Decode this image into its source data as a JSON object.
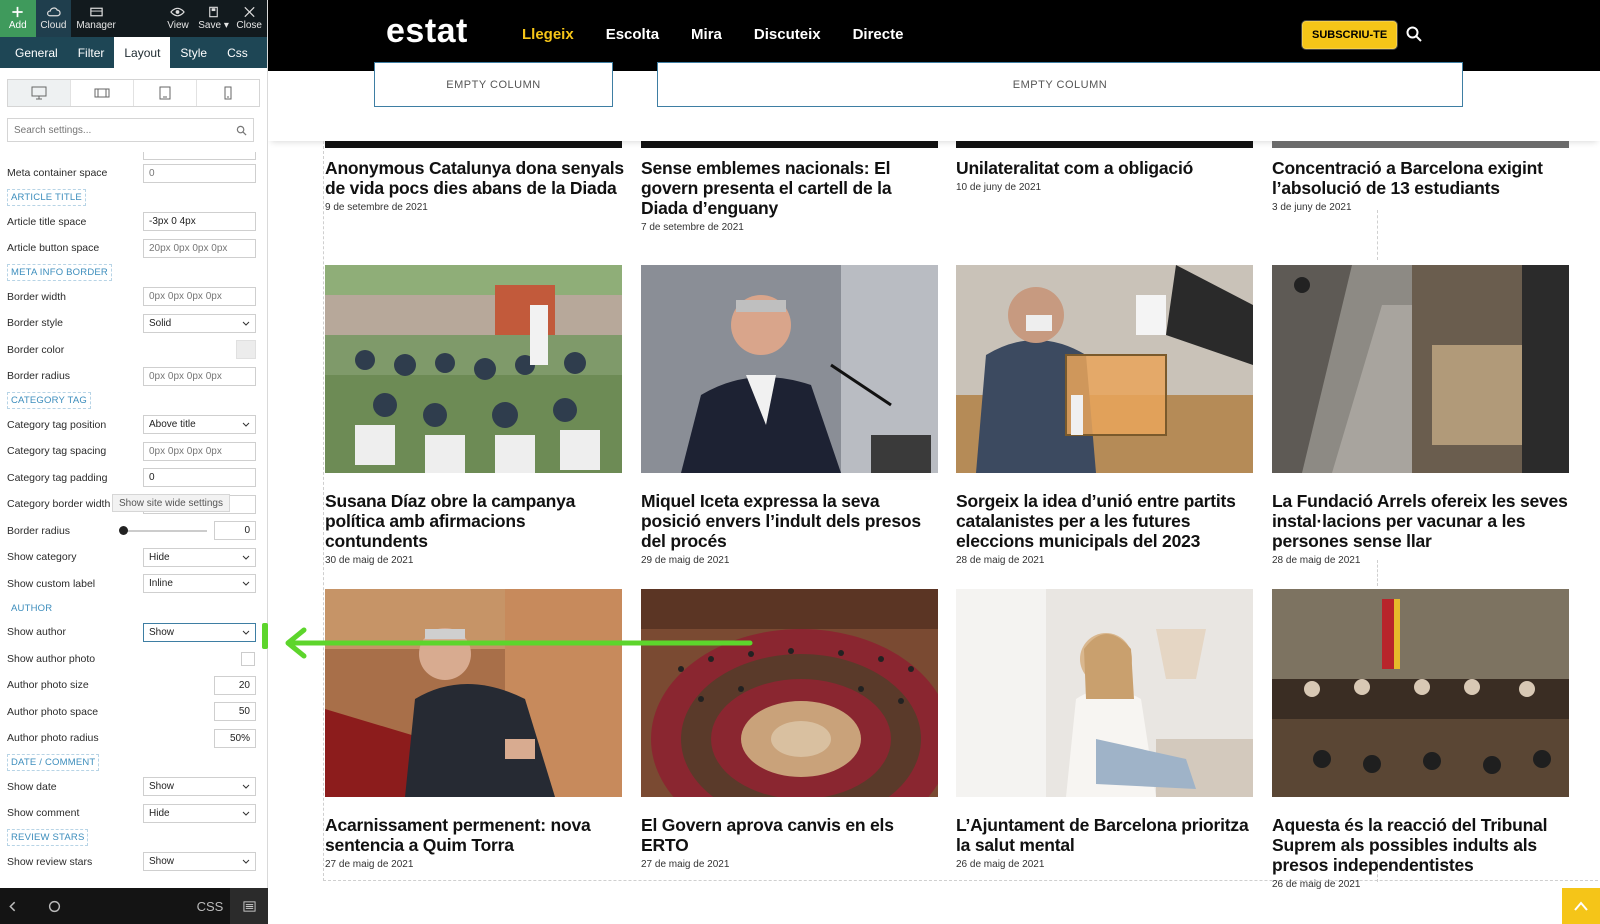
{
  "toolbar": {
    "add": "Add",
    "cloud": "Cloud",
    "manager": "Manager",
    "view": "View",
    "save": "Save",
    "close": "Close"
  },
  "tabs": [
    "General",
    "Filter",
    "Layout",
    "Style",
    "Css"
  ],
  "active_tab": "Layout",
  "search": {
    "placeholder": "Search settings..."
  },
  "settings": {
    "meta_container_space": {
      "label": "Meta container space",
      "value": "0"
    },
    "article_title": {
      "heading": "ARTICLE TITLE",
      "title_space": {
        "label": "Article title space",
        "value": "-3px 0 4px"
      },
      "button_space": {
        "label": "Article button space",
        "value": "20px 0px 0px 0px"
      }
    },
    "meta_info_border": {
      "heading": "META INFO BORDER",
      "width": {
        "label": "Border width",
        "value": "0px 0px 0px 0px"
      },
      "style": {
        "label": "Border style",
        "value": "Solid"
      },
      "color": {
        "label": "Border color"
      },
      "radius": {
        "label": "Border radius",
        "value": "0px 0px 0px 0px"
      }
    },
    "category_tag": {
      "heading": "CATEGORY TAG",
      "position": {
        "label": "Category tag position",
        "value": "Above title"
      },
      "spacing": {
        "label": "Category tag spacing",
        "value": "0px 0px 0px 0px"
      },
      "padding": {
        "label": "Category tag padding",
        "value": "0"
      },
      "border_width": {
        "label": "Category border width"
      },
      "border_radius": {
        "label": "Border radius",
        "value": "0"
      },
      "show_category": {
        "label": "Show category",
        "value": "Hide"
      },
      "show_custom_label": {
        "label": "Show custom label",
        "value": "Inline"
      }
    },
    "author": {
      "heading": "AUTHOR",
      "show_author": {
        "label": "Show author",
        "value": "Show"
      },
      "show_author_photo": {
        "label": "Show author photo"
      },
      "photo_size": {
        "label": "Author photo size",
        "value": "20"
      },
      "photo_space": {
        "label": "Author photo space",
        "value": "50"
      },
      "photo_radius": {
        "label": "Author photo radius",
        "value": "50%"
      }
    },
    "date_comment": {
      "heading": "DATE / COMMENT",
      "show_date": {
        "label": "Show date",
        "value": "Show"
      },
      "show_comment": {
        "label": "Show comment",
        "value": "Hide"
      }
    },
    "review_stars": {
      "heading": "REVIEW STARS",
      "show_review_stars": {
        "label": "Show review stars",
        "value": "Show"
      }
    }
  },
  "tooltip": "Show site wide settings",
  "bottombar": {
    "css": "CSS"
  },
  "site": {
    "logo": "estat",
    "nav": [
      "Llegeix",
      "Escolta",
      "Mira",
      "Discuteix",
      "Directe"
    ],
    "subscribe": "SUBSCRIU-TE",
    "empty_column": "EMPTY COLUMN"
  },
  "articles_top": [
    {
      "title": "Anonymous Catalunya dona senyals de vida pocs dies abans de la Diada",
      "date": "9 de setembre de 2021"
    },
    {
      "title": "Sense emblemes nacionals: El govern presenta el cartell de la Diada d’enguany",
      "date": "7 de setembre de 2021"
    },
    {
      "title": "Unilateralitat com a obligació",
      "date": "10 de juny de 2021"
    },
    {
      "title": "Concentració a Barcelona exigint l’absolució de 13 estudiants",
      "date": "3 de juny de 2021"
    }
  ],
  "articles_mid": [
    {
      "title": "Susana Díaz obre la campanya política amb afirmacions contundents",
      "date": "30 de maig de 2021",
      "image": "outdoor-rally-photo"
    },
    {
      "title": "Miquel Iceta expressa la seva posició envers l’indult dels presos del procés",
      "date": "29 de maig de 2021",
      "image": "politician-podium-photo"
    },
    {
      "title": "Sorgeix la idea d’unió entre partits catalanistes per a les futures eleccions municipals del 2023",
      "date": "28 de maig de 2021",
      "image": "ballot-box-photo"
    },
    {
      "title": "La Fundació Arrels ofereix les seves instal·lacions per vacunar a les persones sense llar",
      "date": "28 de maig de 2021",
      "image": "street-sidewalk-photo"
    }
  ],
  "articles_bottom": [
    {
      "title": "Acarnissament permenent: nova sentencia a Quim Torra",
      "date": "27 de maig de 2021",
      "image": "man-in-court-photo"
    },
    {
      "title": "El Govern aprova canvis en els ERTO",
      "date": "27 de maig de 2021",
      "image": "parliament-chamber-photo"
    },
    {
      "title": "L’Ajuntament de Barcelona prioritza la salut mental",
      "date": "26 de maig de 2021",
      "image": "pensive-woman-photo"
    },
    {
      "title": "Aquesta és la reacció del Tribunal Suprem als possibles indults als presos independentistes",
      "date": "26 de maig de 2021",
      "image": "supreme-court-photo"
    }
  ],
  "colors": {
    "accent_green": "#3f9a5c",
    "nav_active": "#f5c518",
    "section_blue": "#3c8dbc",
    "arrow_green": "#5dd52c"
  }
}
